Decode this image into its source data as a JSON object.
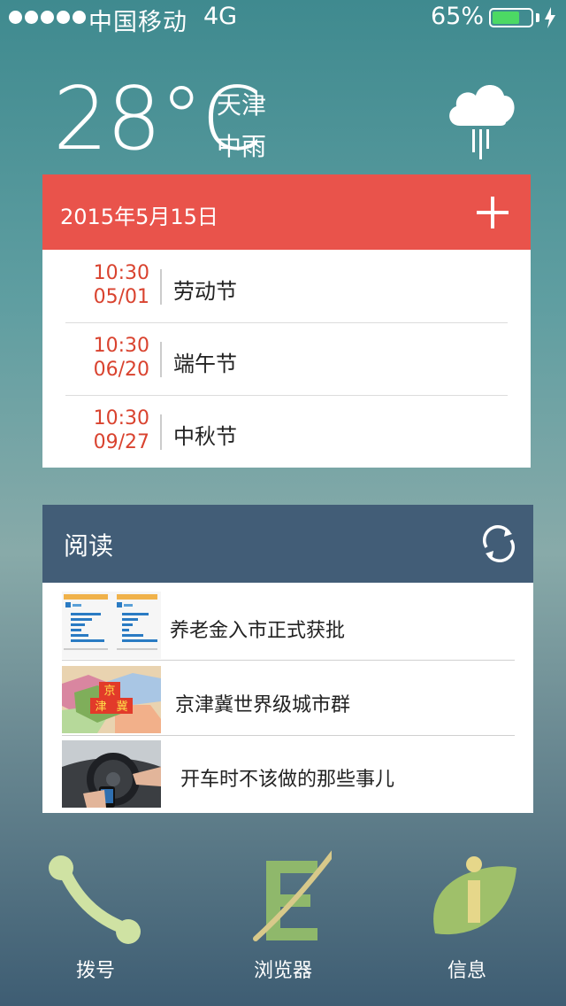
{
  "status_bar": {
    "carrier": "中国移动",
    "network": "4G",
    "battery_percent": "65%",
    "battery_level": 0.65,
    "signal_dots": 5,
    "battery_color": "#4cd964"
  },
  "weather": {
    "temperature": "28°C",
    "city": "天津",
    "condition": "中雨",
    "icon": "rain-cloud-icon"
  },
  "calendar": {
    "date": "2015年5月15日",
    "header_color": "#e9534b",
    "add_icon": "plus-icon",
    "events": [
      {
        "time": "10:30",
        "date": "05/01",
        "name": "劳动节"
      },
      {
        "time": "10:30",
        "date": "06/20",
        "name": "端午节"
      },
      {
        "time": "10:30",
        "date": "09/27",
        "name": "中秋节"
      }
    ]
  },
  "reading": {
    "title": "阅读",
    "header_color": "#425d77",
    "refresh_icon": "refresh-icon",
    "articles": [
      {
        "title": "养老金入市正式获批",
        "thumb": "chart-thumbnail"
      },
      {
        "title": "京津冀世界级城市群",
        "thumb": "map-thumbnail",
        "map_labels": [
          "京",
          "津",
          "冀"
        ]
      },
      {
        "title": "开车时不该做的那些事儿",
        "thumb": "car-interior-thumbnail"
      }
    ]
  },
  "dock": [
    {
      "label": "拨号",
      "icon": "phone-icon"
    },
    {
      "label": "浏览器",
      "icon": "browser-icon"
    },
    {
      "label": "信息",
      "icon": "info-leaf-icon"
    }
  ]
}
